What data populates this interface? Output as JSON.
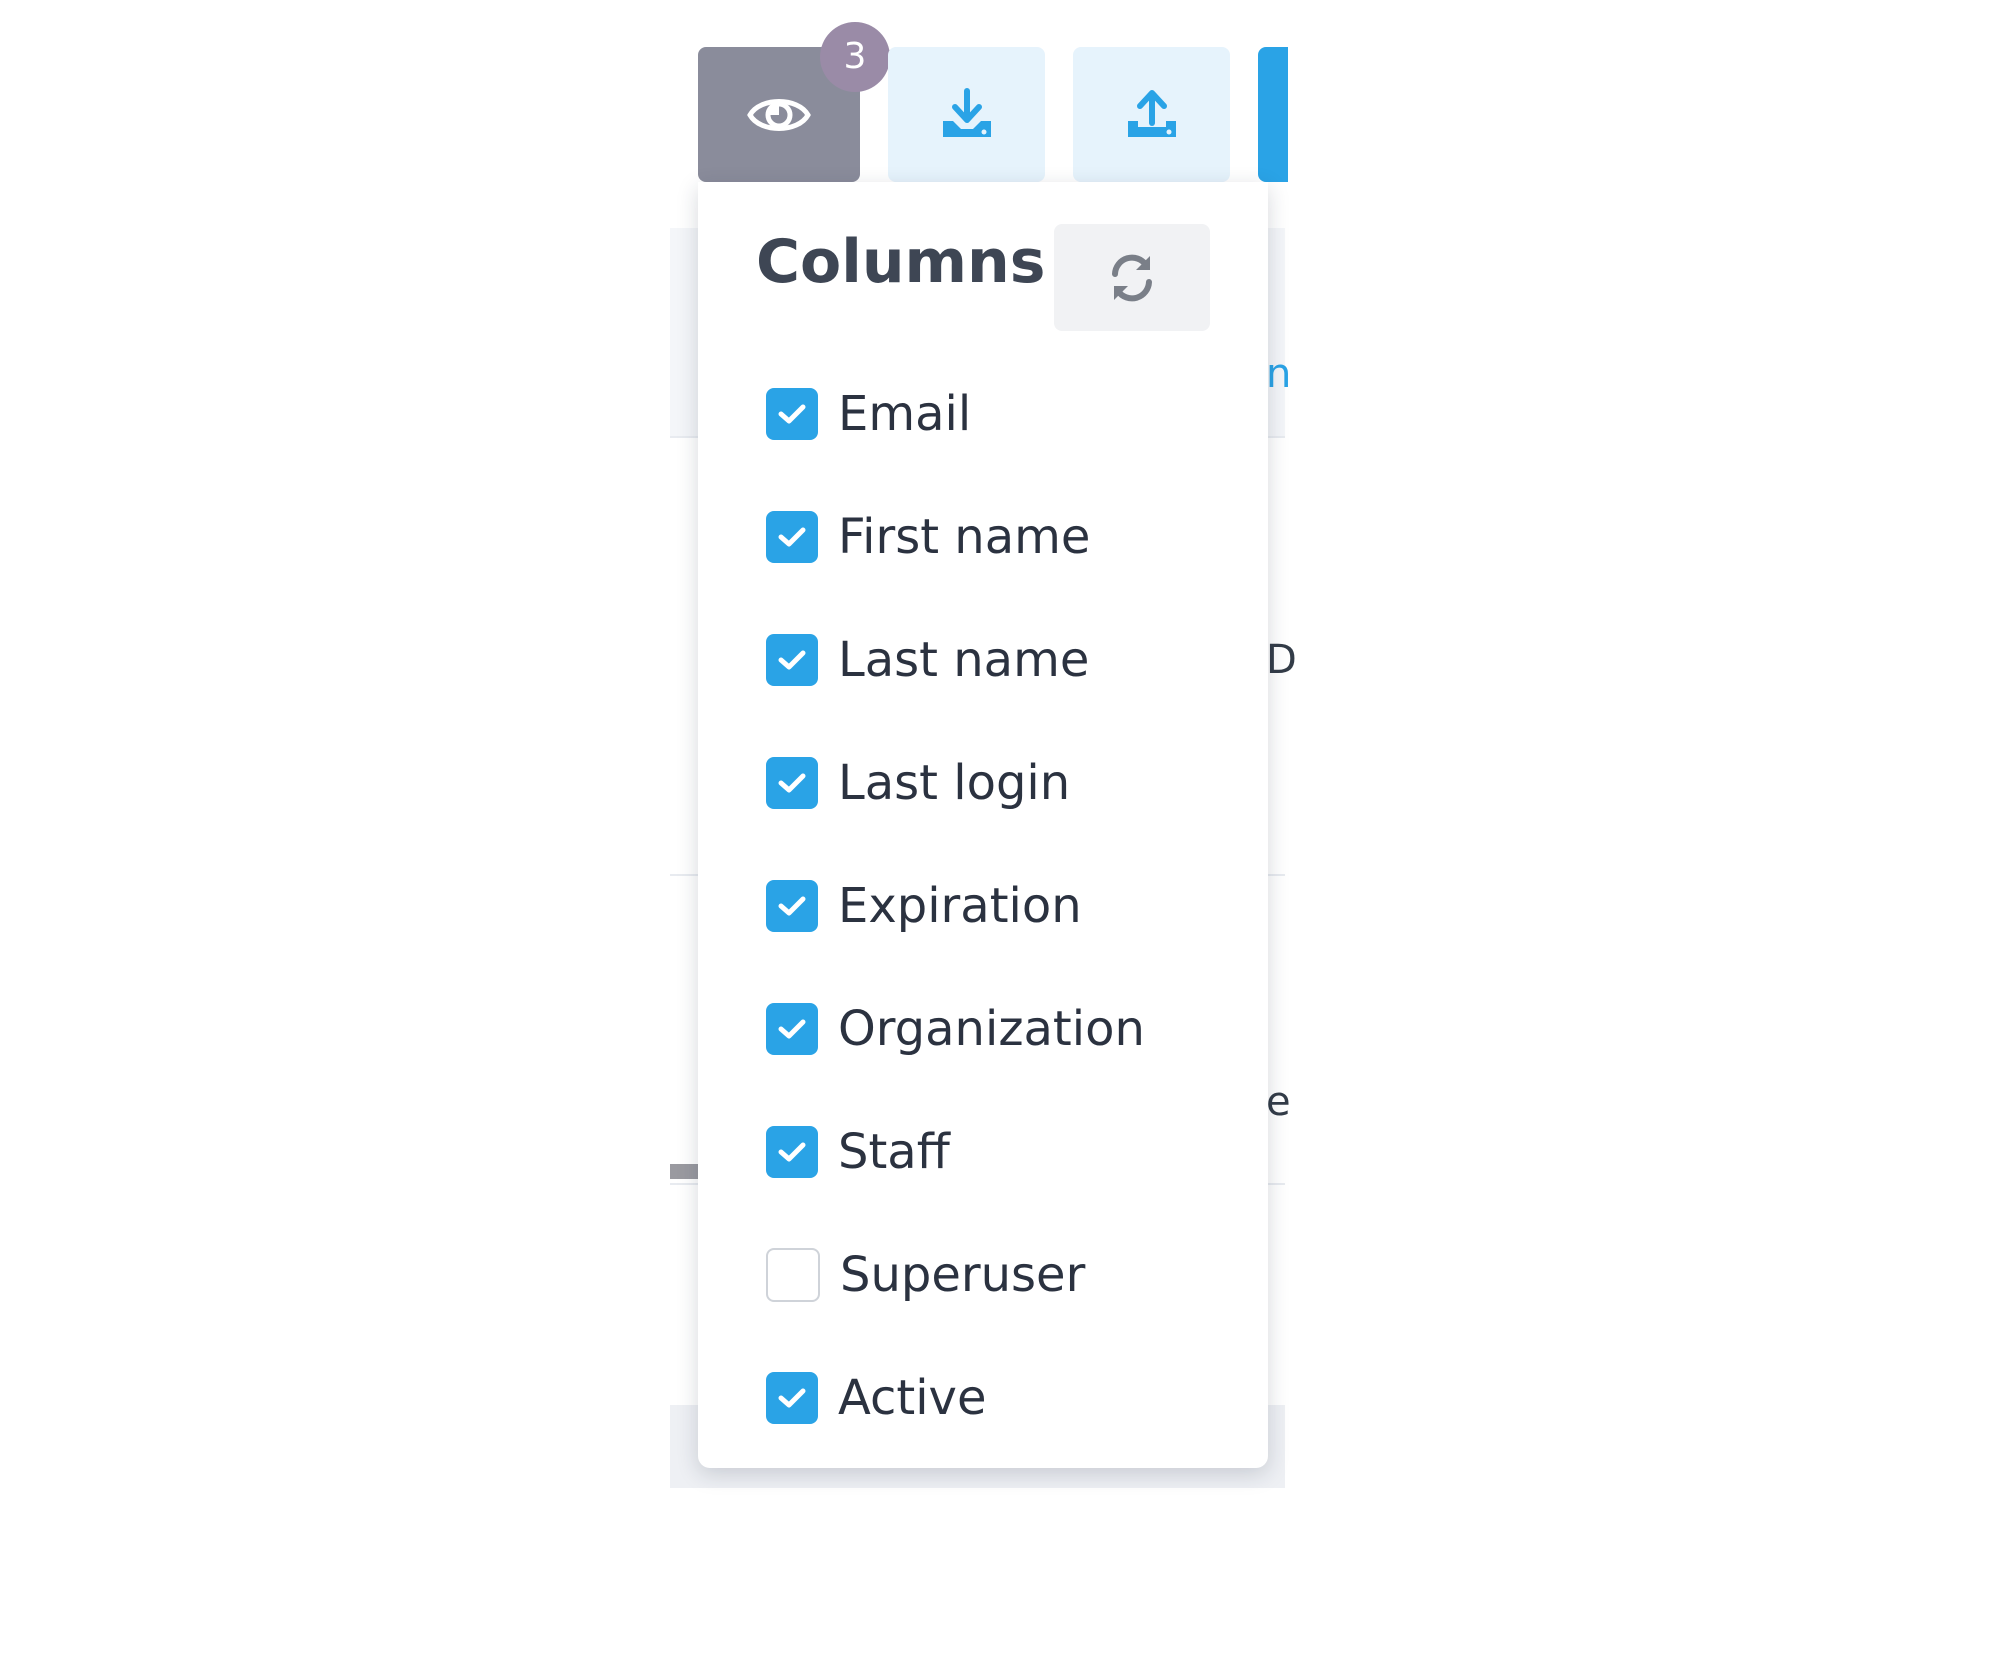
{
  "toolbar": {
    "badge_count": "3",
    "buttons": [
      {
        "icon": "eye-icon"
      },
      {
        "icon": "download-icon"
      },
      {
        "icon": "upload-icon"
      }
    ]
  },
  "popover": {
    "title": "Columns",
    "reset_icon": "refresh-icon",
    "columns": [
      {
        "label": "Email",
        "checked": true
      },
      {
        "label": "First name",
        "checked": true
      },
      {
        "label": "Last name",
        "checked": true
      },
      {
        "label": "Last login",
        "checked": true
      },
      {
        "label": "Expiration",
        "checked": true
      },
      {
        "label": "Organization",
        "checked": true
      },
      {
        "label": "Staff",
        "checked": true
      },
      {
        "label": "Superuser",
        "checked": false
      },
      {
        "label": "Active",
        "checked": true
      }
    ]
  },
  "background_fragments": [
    "n",
    "D",
    "e"
  ],
  "colors": {
    "accent": "#2aa3e6",
    "button_muted": "#8a8c9b",
    "badge": "#9a8ba7",
    "button_light": "#e6f3fc"
  }
}
